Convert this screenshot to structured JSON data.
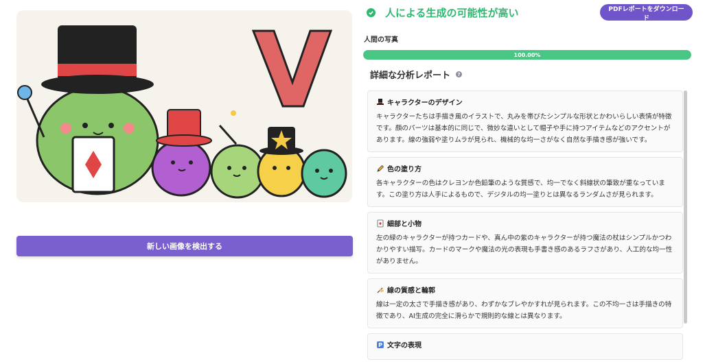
{
  "image": {
    "alt": "image",
    "big_letter": "V"
  },
  "detect_button": "新しい画像を検出する",
  "result": {
    "title": "人による生成の可能性が高い",
    "label": "人間の写真",
    "progress_text": "100.00%",
    "progress_value": 1.0,
    "color": "#2eb872"
  },
  "pdf_button": "PDFレポートをダウンロード",
  "report": {
    "title": "詳細な分析レポート",
    "help": "?",
    "cards": [
      {
        "icon": "top-hat-icon",
        "title": "キャラクターのデザイン",
        "body": "キャラクターたちは手描き風のイラストで、丸みを帯びたシンプルな形状とかわいらしい表情が特徴です。顔のパーツは基本的に同じで、微妙な違いとして帽子や手に持つアイテムなどのアクセントがあります。線の強弱や塗りムラが見られ、機械的な均一さがなく自然な手描き感が強いです。"
      },
      {
        "icon": "pencil-icon",
        "title": "色の塗り方",
        "body": "各キャラクターの色はクレヨンか色鉛筆のような質感で、均一でなく斜線状の筆致が重なっています。この塗り方は人手によるもので、デジタルの均一塗りとは異なるランダムさが見られます。"
      },
      {
        "icon": "playing-card-icon",
        "title": "細部と小物",
        "body": "左の緑のキャラクターが持つカードや、真ん中の紫のキャラクターが持つ魔法の杖はシンプルかつわかりやすい描写。カードのマークや魔法の光の表現も手書き感のあるラフさがあり、人工的な均一性がありません。"
      },
      {
        "icon": "writing-hand-icon",
        "title": "線の質感と輪郭",
        "body": "線は一定の太さで手描き感があり、わずかなブレやかすれが見られます。この不均一さは手描きの特徴であり、AI生成の完全に滑らかで規則的な線とは異なります。"
      },
      {
        "icon": "parking-sign-icon",
        "title": "文字の表現",
        "body": ""
      }
    ]
  }
}
